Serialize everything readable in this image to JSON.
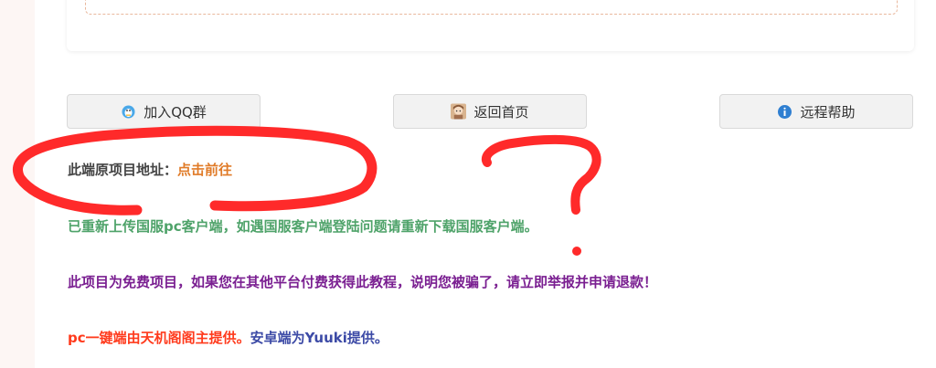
{
  "buttons": {
    "join_qq": "加入QQ群",
    "home": "返回首页",
    "remote_help": "远程帮助"
  },
  "project": {
    "label": "此端原项目地址：",
    "link": "点击前往"
  },
  "notices": {
    "reupload": "已重新上传国服pc客户端，如遇国服客户端登陆问题请重新下载国服客户端。",
    "free_warning": "此项目为免费项目，如果您在其他平台付费获得此教程，说明您被骗了，请立即举报并申请退款！",
    "credit_pc": "pc一键端由天机阁阁主提供。",
    "credit_android": "安卓端为Yuuki提供。"
  },
  "colors": {
    "link": "#e07b28",
    "reupload": "#4fa36a",
    "warning": "#7a1f91",
    "credit_pc": "#ff3a1c",
    "credit_android": "#3c4aa6",
    "annotation": "#ff2a2a"
  },
  "icons": {
    "join_qq": "qq-penguin-icon",
    "home": "avatar-icon",
    "remote_help": "info-icon"
  }
}
